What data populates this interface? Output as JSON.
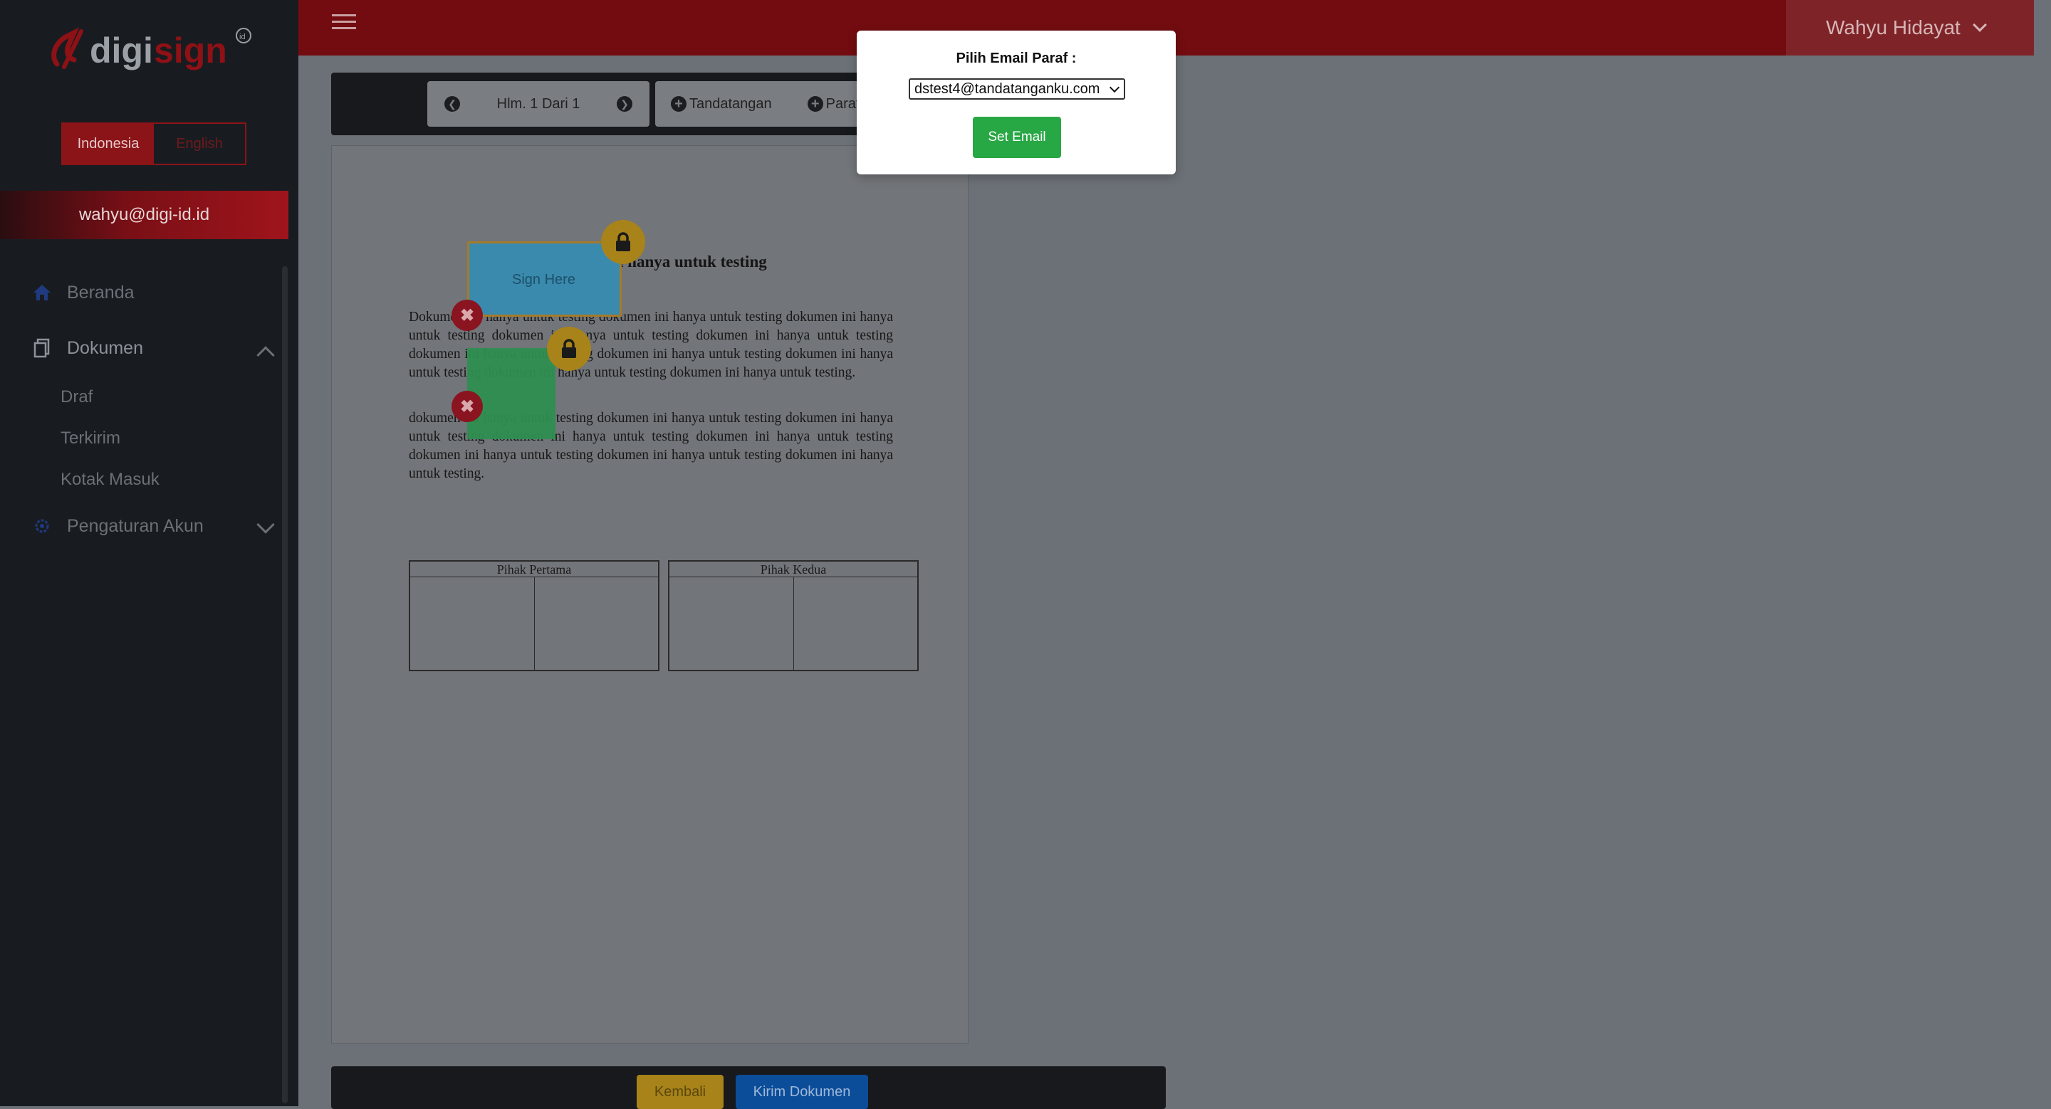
{
  "sidebar": {
    "logo_text": "digisign",
    "logo_accent": "#d01b24",
    "lang_options": [
      "Indonesia",
      "English"
    ],
    "active_lang": "Indonesia",
    "user_email": "wahyu@digi-id.id",
    "menu": {
      "home": "Beranda",
      "documents": "Dokumen",
      "sub": [
        "Draf",
        "Terkirim",
        "Kotak Masuk"
      ],
      "settings": "Pengaturan Akun"
    }
  },
  "topbar": {
    "user_name": "Wahyu Hidayat",
    "color": "#730c10"
  },
  "toolbar": {
    "page_label": "Hlm. 1 Dari 1",
    "sign_label": "Tandatangan",
    "paraf_label": "Paraf"
  },
  "document": {
    "title": "Dokumen ini hanya untuk testing",
    "para1": "Dokumen ini hanya untuk testing dokumen ini hanya untuk testing dokumen ini hanya untuk testing dokumen ini hanya untuk testing dokumen ini hanya untuk testing dokumen ini hanya untuk testing dokumen ini hanya untuk testing dokumen ini hanya untuk testing dokumen ini hanya untuk testing dokumen ini hanya untuk testing.",
    "para2": "dokumen ini hanya untuk testing dokumen ini hanya untuk testing dokumen ini hanya untuk testing dokumen ini hanya untuk testing dokumen ini hanya untuk testing dokumen ini hanya untuk testing dokumen ini hanya untuk testing dokumen ini hanya untuk testing.",
    "party1": "Pihak Pertama",
    "party2": "Pihak Kedua",
    "sign_placeholder": "Sign Here"
  },
  "footer": {
    "back_label": "Kembali",
    "send_label": "Kirim Dokumen"
  },
  "modal": {
    "label": "Pilih Email Paraf :",
    "selected_email": "dstest4@tandatanganku.com",
    "button_label": "Set Email",
    "button_color": "#28a745"
  }
}
